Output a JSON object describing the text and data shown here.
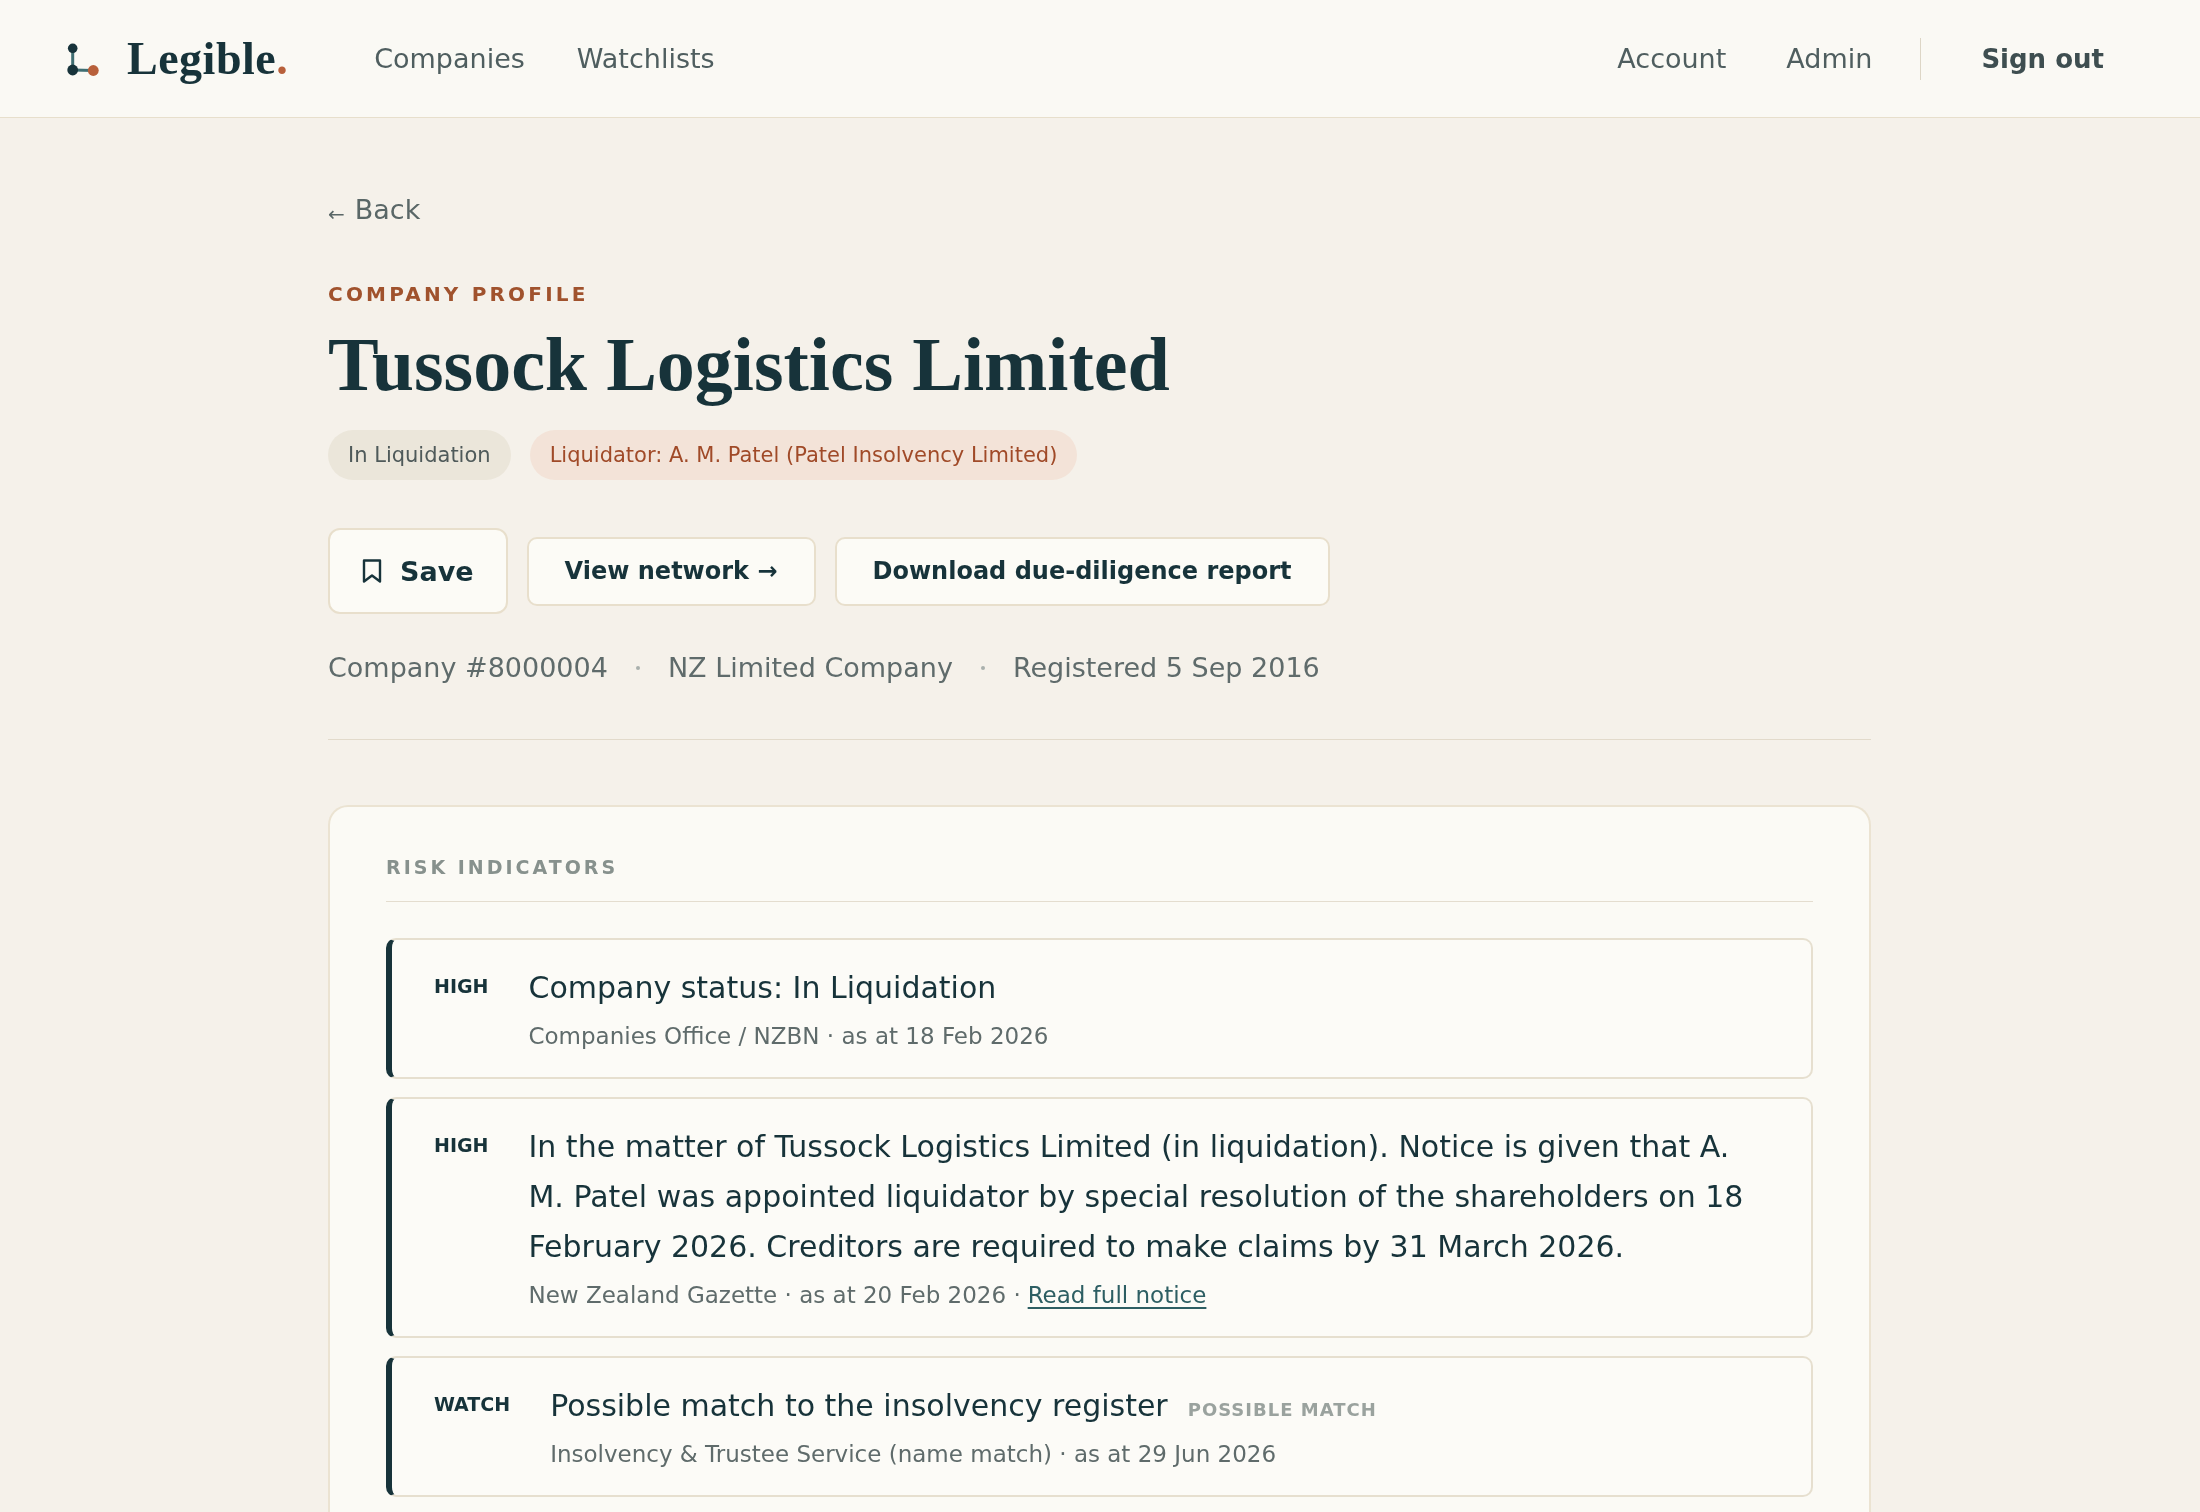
{
  "header": {
    "logo": {
      "name": "Legible",
      "mark": "."
    },
    "nav": [
      "Companies",
      "Watchlists"
    ],
    "account_links": [
      "Account",
      "Admin"
    ],
    "sign_out": "Sign out"
  },
  "back": {
    "icon": "←",
    "label": "Back"
  },
  "eyebrow": "COMPANY PROFILE",
  "title": "Tussock Logistics Limited",
  "badges": [
    {
      "kind": "status",
      "label": "In Liquidation"
    },
    {
      "kind": "liquidator",
      "label": "Liquidator: A. M. Patel (Patel Insolvency Limited)"
    }
  ],
  "actions": [
    {
      "kind": "save",
      "label": "Save",
      "saved": false
    },
    {
      "kind": "plain",
      "label": "View network →"
    },
    {
      "kind": "plain",
      "label": "Download due-diligence report"
    }
  ],
  "facts": [
    "Company #8000004",
    "NZ Limited Company",
    "Registered 5 Sep 2016"
  ],
  "risk_indicators": {
    "heading": "RISK INDICATORS",
    "items": [
      {
        "severity": "HIGH",
        "title": "Company status: In Liquidation",
        "source": "Companies Office / NZBN · as at 18 Feb 2026"
      },
      {
        "severity": "HIGH",
        "title": "In the matter of Tussock Logistics Limited (in liquidation). Notice is given that A. M. Patel was appointed liquidator by special resolution of the shareholders on 18 February 2026. Creditors are required to make claims by 31 March 2026.",
        "source": "New Zealand Gazette · as at 20 Feb 2026 ·",
        "link": "Read full notice"
      },
      {
        "severity": "WATCH",
        "title": "Possible match to the insolvency register",
        "tag": "POSSIBLE MATCH",
        "source": "Insolvency & Trustee Service (name match) · as at 29 Jun 2026"
      }
    ]
  }
}
